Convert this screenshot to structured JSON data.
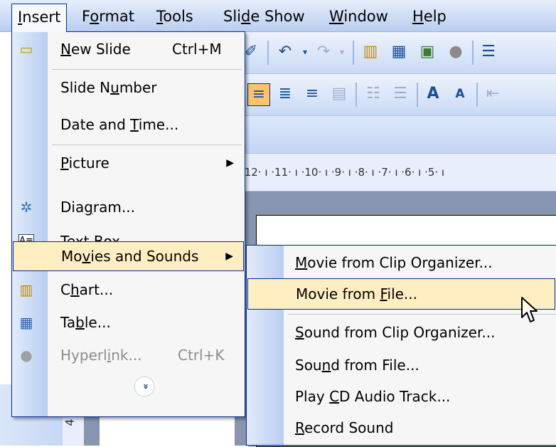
{
  "menubar": {
    "items": [
      {
        "pre": "",
        "hk": "I",
        "post": "nsert"
      },
      {
        "pre": "F",
        "hk": "o",
        "post": "rmat"
      },
      {
        "pre": "",
        "hk": "T",
        "post": "ools"
      },
      {
        "pre": "Sli",
        "hk": "d",
        "post": "e Show"
      },
      {
        "pre": "",
        "hk": "W",
        "post": "indow"
      },
      {
        "pre": "",
        "hk": "H",
        "post": "elp"
      }
    ]
  },
  "ruler": {
    "text": "ı ·12· ı ·11· ı ·10· ı ·9· ı ·8· ı ·7· ı ·6· ı ·5· ı"
  },
  "vruler": {
    "text": "4"
  },
  "insert_menu": {
    "items": [
      {
        "pre": "",
        "hk": "N",
        "post": "ew Slide",
        "shortcut": "Ctrl+M",
        "icon": "new-slide-icon"
      },
      {
        "pre": "Slide N",
        "hk": "u",
        "post": "mber"
      },
      {
        "pre": "Date and ",
        "hk": "T",
        "post": "ime..."
      },
      {
        "pre": "",
        "hk": "P",
        "post": "icture",
        "arrow": "▶"
      },
      {
        "pre": "Dia",
        "hk": "g",
        "post": "ram...",
        "icon": "diagram-icon"
      },
      {
        "pre": "Te",
        "hk": "x",
        "post": "t Box",
        "icon": "text-box-icon"
      },
      {
        "pre": "Mo",
        "hk": "v",
        "post": "ies and Sounds",
        "arrow": "▶"
      },
      {
        "pre": "C",
        "hk": "h",
        "post": "art...",
        "icon": "chart-icon"
      },
      {
        "pre": "Ta",
        "hk": "b",
        "post": "le...",
        "icon": "table-icon"
      },
      {
        "pre": "Hyperl",
        "hk": "i",
        "post": "nk...",
        "shortcut": "Ctrl+K",
        "icon": "hyperlink-icon"
      }
    ],
    "expand_glyph": "»"
  },
  "submenu": {
    "items": [
      {
        "pre": "",
        "hk": "M",
        "post": "ovie from Clip Organizer..."
      },
      {
        "pre": "Movie from ",
        "hk": "F",
        "post": "ile..."
      },
      {
        "pre": "",
        "hk": "S",
        "post": "ound from Clip Organizer..."
      },
      {
        "pre": "Sou",
        "hk": "n",
        "post": "d from File..."
      },
      {
        "pre": "Play ",
        "hk": "C",
        "post": "D Audio Track..."
      },
      {
        "pre": "",
        "hk": "R",
        "post": "ecord Sound"
      }
    ]
  },
  "colors": {
    "menu_border": "#002d96",
    "highlight": "#ffeec2",
    "gutter": "#c6d8f4",
    "menubar": "#c7d8f4"
  }
}
